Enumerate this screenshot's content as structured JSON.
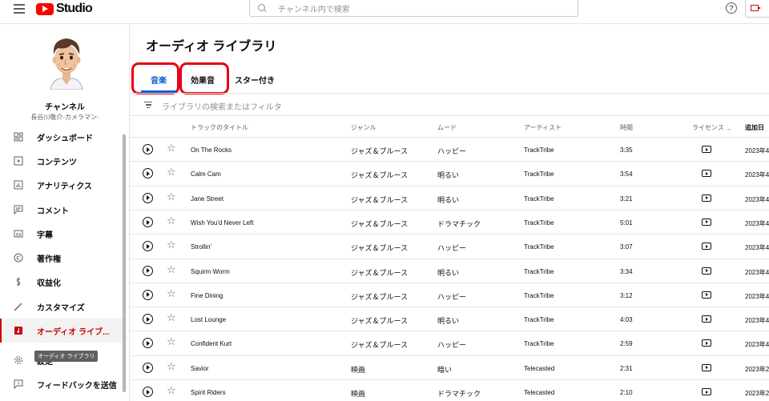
{
  "header": {
    "logo_text": "Studio",
    "search_placeholder": "チャンネル内で検索",
    "help_icon": "?"
  },
  "sidebar": {
    "channel_name": "チャンネル",
    "channel_sub": "長谷川敬介-カメラマン-",
    "items": [
      {
        "label": "ダッシュボード",
        "icon": "dashboard-icon"
      },
      {
        "label": "コンテンツ",
        "icon": "content-icon"
      },
      {
        "label": "アナリティクス",
        "icon": "analytics-icon"
      },
      {
        "label": "コメント",
        "icon": "comments-icon"
      },
      {
        "label": "字幕",
        "icon": "subtitles-icon"
      },
      {
        "label": "著作権",
        "icon": "copyright-icon"
      },
      {
        "label": "収益化",
        "icon": "monetization-icon"
      },
      {
        "label": "カスタマイズ",
        "icon": "customize-icon"
      },
      {
        "label": "オーディオ ライブ...",
        "icon": "audio-library-icon",
        "active": true
      },
      {
        "label": "設定",
        "icon": "settings-icon"
      },
      {
        "label": "フィードバックを送信",
        "icon": "feedback-icon"
      }
    ],
    "tooltip": "オーディオ ライブラリ"
  },
  "main": {
    "title": "オーディオ ライブラリ",
    "tabs": [
      {
        "label": "音楽",
        "active": true
      },
      {
        "label": "効果音"
      },
      {
        "label": "スター付き"
      }
    ],
    "filter_placeholder": "ライブラリの検索またはフィルタ",
    "columns": {
      "title": "トラックのタイトル",
      "genre": "ジャンル",
      "mood": "ムード",
      "artist": "アーティスト",
      "duration": "時間",
      "license": "ライセンス ...",
      "added": "追加日"
    },
    "tracks": [
      {
        "title": "On The Rocks",
        "genre": "ジャズ＆ブルース",
        "mood": "ハッピー",
        "artist": "TrackTribe",
        "duration": "3:35",
        "added": "2023年4"
      },
      {
        "title": "Calm Cam",
        "genre": "ジャズ＆ブルース",
        "mood": "明るい",
        "artist": "TrackTribe",
        "duration": "3:54",
        "added": "2023年4"
      },
      {
        "title": "Jane Street",
        "genre": "ジャズ＆ブルース",
        "mood": "明るい",
        "artist": "TrackTribe",
        "duration": "3:21",
        "added": "2023年4"
      },
      {
        "title": "Wish You'd Never Left",
        "genre": "ジャズ＆ブルース",
        "mood": "ドラマチック",
        "artist": "TrackTribe",
        "duration": "5:01",
        "added": "2023年4"
      },
      {
        "title": "Strollin'",
        "genre": "ジャズ＆ブルース",
        "mood": "ハッピー",
        "artist": "TrackTribe",
        "duration": "3:07",
        "added": "2023年4"
      },
      {
        "title": "Squirm Worm",
        "genre": "ジャズ＆ブルース",
        "mood": "明るい",
        "artist": "TrackTribe",
        "duration": "3:34",
        "added": "2023年4"
      },
      {
        "title": "Fine Dining",
        "genre": "ジャズ＆ブルース",
        "mood": "ハッピー",
        "artist": "TrackTribe",
        "duration": "3:12",
        "added": "2023年4"
      },
      {
        "title": "Lost Lounge",
        "genre": "ジャズ＆ブルース",
        "mood": "明るい",
        "artist": "TrackTribe",
        "duration": "4:03",
        "added": "2023年4"
      },
      {
        "title": "Confident Kurt",
        "genre": "ジャズ＆ブルース",
        "mood": "ハッピー",
        "artist": "TrackTribe",
        "duration": "2:59",
        "added": "2023年4"
      },
      {
        "title": "Savior",
        "genre": "映画",
        "mood": "暗い",
        "artist": "Telecasted",
        "duration": "2:31",
        "added": "2023年2"
      },
      {
        "title": "Spirit Riders",
        "genre": "映画",
        "mood": "ドラマチック",
        "artist": "Telecasted",
        "duration": "2:10",
        "added": "2023年2"
      }
    ]
  },
  "colors": {
    "accent_red": "#cc0000",
    "highlight_ring": "#e60012",
    "tab_underline": "#065fd4"
  }
}
